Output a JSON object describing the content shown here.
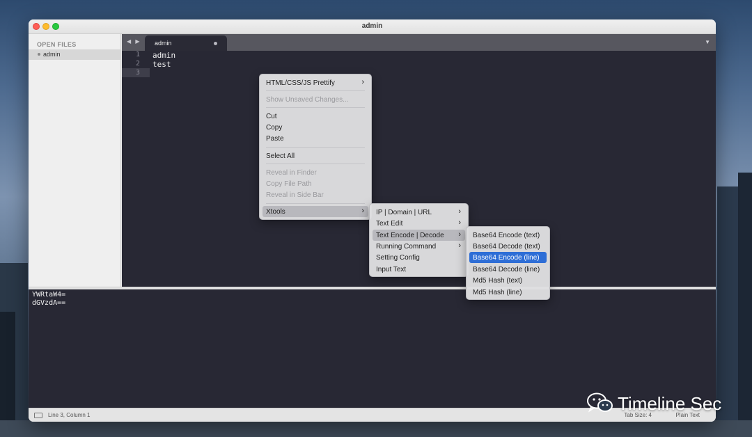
{
  "window": {
    "title": "admin"
  },
  "sidebar": {
    "header": "OPEN FILES",
    "files": [
      {
        "label": "admin"
      }
    ]
  },
  "tabbar": {
    "nav_arrows": "◀ ▶",
    "active_tab": "admin",
    "menu_glyph": "▼"
  },
  "editor": {
    "lines": [
      {
        "num": "1",
        "text": "admin"
      },
      {
        "num": "2",
        "text": "test"
      },
      {
        "num": "3",
        "text": ""
      }
    ]
  },
  "output": {
    "lines": [
      "YWRtaW4=",
      "dGVzdA=="
    ]
  },
  "statusbar": {
    "position": "Line 3, Column 1",
    "tab_size": "Tab Size: 4",
    "syntax": "Plain Text"
  },
  "context_menu": {
    "items": [
      {
        "label": "HTML/CSS/JS Prettify",
        "submenu": true
      },
      {
        "label": "Show Unsaved Changes...",
        "disabled": true
      },
      {
        "label": "Cut"
      },
      {
        "label": "Copy"
      },
      {
        "label": "Paste"
      },
      {
        "label": "Select All"
      },
      {
        "label": "Reveal in Finder",
        "disabled": true
      },
      {
        "label": "Copy File Path",
        "disabled": true
      },
      {
        "label": "Reveal in Side Bar",
        "disabled": true
      },
      {
        "label": "Xtools",
        "submenu": true
      }
    ]
  },
  "xtools_menu": {
    "items": [
      {
        "label": "IP | Domain | URL",
        "submenu": true
      },
      {
        "label": "Text Edit",
        "submenu": true
      },
      {
        "label": "Text Encode | Decode",
        "submenu": true
      },
      {
        "label": "Running Command",
        "submenu": true
      },
      {
        "label": "Setting Config"
      },
      {
        "label": "Input Text"
      }
    ]
  },
  "encode_menu": {
    "items": [
      {
        "label": "Base64 Encode (text)"
      },
      {
        "label": "Base64 Decode (text)"
      },
      {
        "label": "Base64 Encode (line)"
      },
      {
        "label": "Base64 Decode (line)"
      },
      {
        "label": "Md5 Hash (text)"
      },
      {
        "label": "Md5 Hash (line)"
      }
    ]
  },
  "submenu_arrow": "›",
  "watermark": {
    "text": "Timeline Sec",
    "icon": "wechat-icon"
  },
  "colors": {
    "selection": "#2e6ed6",
    "editor_bg": "#282834"
  }
}
